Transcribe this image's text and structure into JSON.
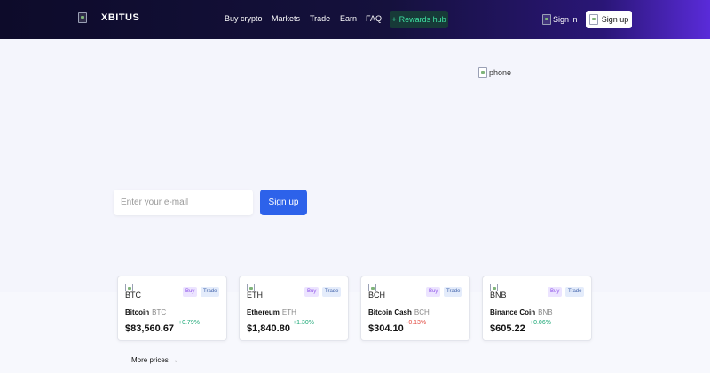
{
  "header": {
    "brand": "XBITUS",
    "nav": [
      "Buy crypto",
      "Markets",
      "Trade",
      "Earn",
      "FAQ"
    ],
    "rewards_label": "Rewards hub",
    "signin_label": "Sign in",
    "signup_label": "Sign up"
  },
  "hero": {
    "phone_alt": "phone",
    "email_placeholder": "Enter your e-mail",
    "signup_label": "Sign up"
  },
  "coins": [
    {
      "code": "BTC",
      "name": "Bitcoin",
      "symbol": "BTC",
      "price": "$83,560.67",
      "change": "+0.79%",
      "direction": "up",
      "buy": "Buy",
      "trade": "Trade"
    },
    {
      "code": "ETH",
      "name": "Ethereum",
      "symbol": "ETH",
      "price": "$1,840.80",
      "change": "+1.30%",
      "direction": "up",
      "buy": "Buy",
      "trade": "Trade"
    },
    {
      "code": "BCH",
      "name": "Bitcoin Cash",
      "symbol": "BCH",
      "price": "$304.10",
      "change": "-0.13%",
      "direction": "down",
      "buy": "Buy",
      "trade": "Trade"
    },
    {
      "code": "BNB",
      "name": "Binance Coin",
      "symbol": "BNB",
      "price": "$605.22",
      "change": "+0.06%",
      "direction": "up",
      "buy": "Buy",
      "trade": "Trade"
    }
  ],
  "more_prices": "More prices",
  "colors": {
    "accent": "#2d62ea",
    "rewards_text": "#3fe3a3",
    "positive": "#17a673",
    "negative": "#e0453b"
  }
}
